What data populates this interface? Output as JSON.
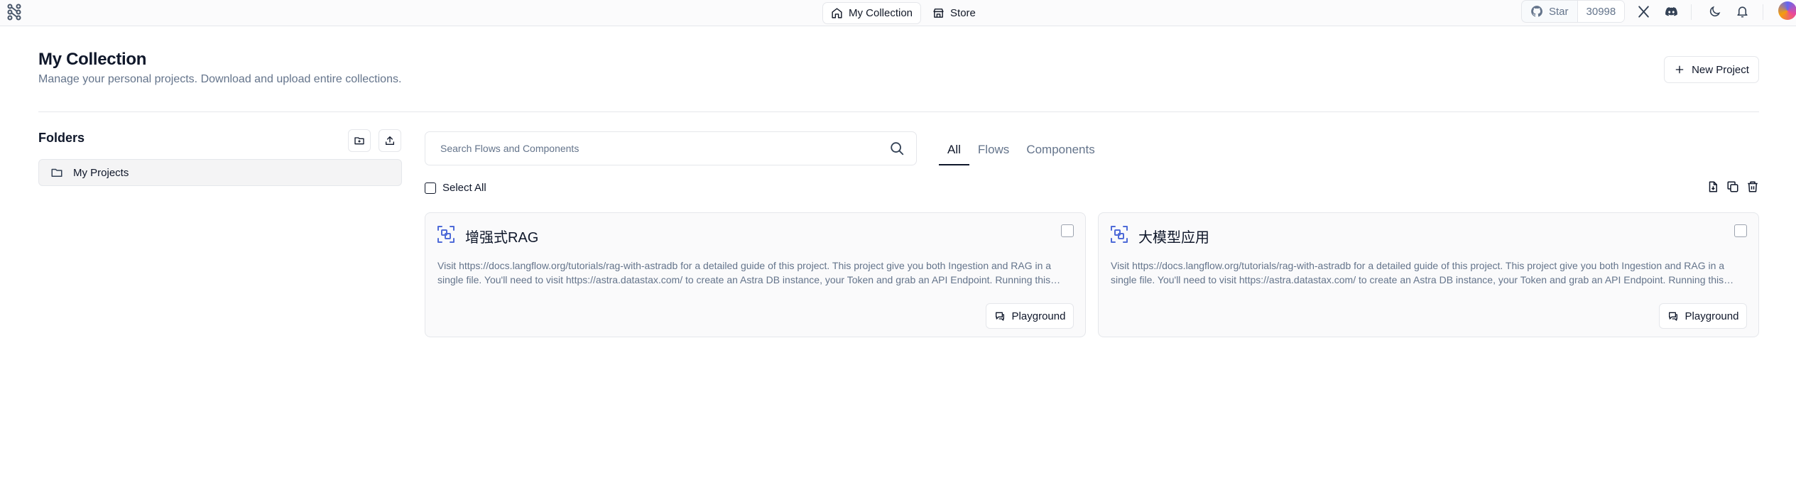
{
  "nav": {
    "my_collection": "My Collection",
    "store": "Store",
    "star_label": "Star",
    "star_count": "30998"
  },
  "header": {
    "title": "My Collection",
    "subtitle": "Manage your personal projects. Download and upload entire collections.",
    "new_project": "New Project"
  },
  "sidebar": {
    "title": "Folders",
    "items": [
      {
        "label": "My Projects"
      }
    ]
  },
  "search": {
    "placeholder": "Search Flows and Components",
    "value": ""
  },
  "tabs": [
    {
      "label": "All"
    },
    {
      "label": "Flows"
    },
    {
      "label": "Components"
    }
  ],
  "select_all": "Select All",
  "cards": [
    {
      "title": "增强式RAG",
      "description": "Visit https://docs.langflow.org/tutorials/rag-with-astradb for a detailed guide of this project. This project give you both Ingestion and RAG in a single file. You'll need to visit https://astra.datastax.com/ to create an Astra DB instance, your Token and grab an API Endpoint. Running this project requires you to add a file in the Files component, then define a Collection Name and click on the Play icon on the Astra DB component.",
      "button": "Playground"
    },
    {
      "title": "大模型应用",
      "description": "Visit https://docs.langflow.org/tutorials/rag-with-astradb for a detailed guide of this project. This project give you both Ingestion and RAG in a single file. You'll need to visit https://astra.datastax.com/ to create an Astra DB instance, your Token and grab an API Endpoint. Running this project requires you to add a file in the Files component, then define a Collection Name and click on the Play icon on the Astra DB component.",
      "button": "Playground"
    }
  ],
  "colors": {
    "text": "#0f172a",
    "muted": "#64748b",
    "accent_icon": "#4f6bd8",
    "border": "#e5e7eb"
  },
  "icons": [
    "langflow-logo-icon",
    "home-icon",
    "store-icon",
    "github-icon",
    "x-icon",
    "discord-icon",
    "moon-icon",
    "bell-icon",
    "plus-icon",
    "folder-plus-icon",
    "upload-icon",
    "folder-icon",
    "search-icon",
    "download-icon",
    "copy-icon",
    "trash-icon",
    "flow-icon",
    "playground-icon"
  ]
}
